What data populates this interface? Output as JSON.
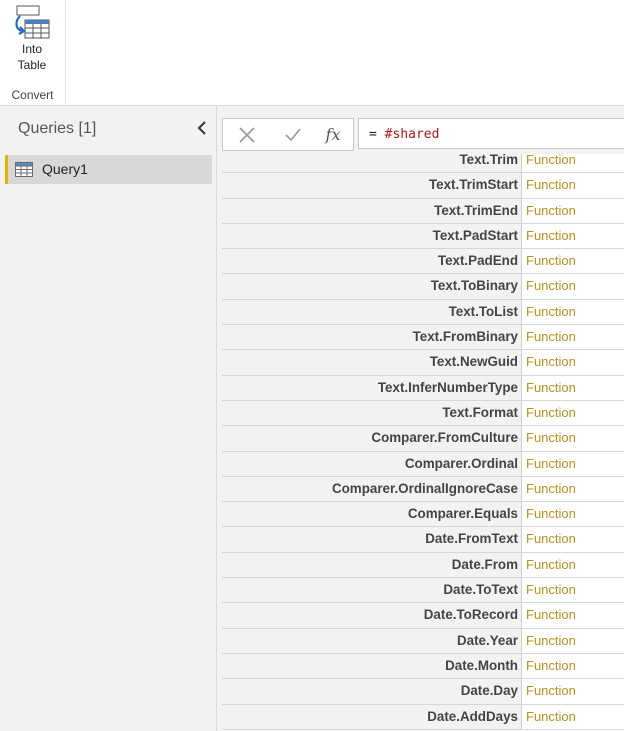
{
  "ribbon": {
    "into_table_line1": "Into",
    "into_table_line2": "Table",
    "group_label": "Convert"
  },
  "queries": {
    "title": "Queries [1]",
    "items": [
      {
        "name": "Query1"
      }
    ]
  },
  "formula": {
    "prefix": "= ",
    "keyword": "#shared"
  },
  "colors": {
    "accent": "#e8b100",
    "function_link": "#b8911f",
    "formula_keyword": "#b0161b"
  },
  "rows": [
    {
      "name": "Text.Trim",
      "value": "Function"
    },
    {
      "name": "Text.TrimStart",
      "value": "Function"
    },
    {
      "name": "Text.TrimEnd",
      "value": "Function"
    },
    {
      "name": "Text.PadStart",
      "value": "Function"
    },
    {
      "name": "Text.PadEnd",
      "value": "Function"
    },
    {
      "name": "Text.ToBinary",
      "value": "Function"
    },
    {
      "name": "Text.ToList",
      "value": "Function"
    },
    {
      "name": "Text.FromBinary",
      "value": "Function"
    },
    {
      "name": "Text.NewGuid",
      "value": "Function"
    },
    {
      "name": "Text.InferNumberType",
      "value": "Function"
    },
    {
      "name": "Text.Format",
      "value": "Function"
    },
    {
      "name": "Comparer.FromCulture",
      "value": "Function"
    },
    {
      "name": "Comparer.Ordinal",
      "value": "Function"
    },
    {
      "name": "Comparer.OrdinalIgnoreCase",
      "value": "Function"
    },
    {
      "name": "Comparer.Equals",
      "value": "Function"
    },
    {
      "name": "Date.FromText",
      "value": "Function"
    },
    {
      "name": "Date.From",
      "value": "Function"
    },
    {
      "name": "Date.ToText",
      "value": "Function"
    },
    {
      "name": "Date.ToRecord",
      "value": "Function"
    },
    {
      "name": "Date.Year",
      "value": "Function"
    },
    {
      "name": "Date.Month",
      "value": "Function"
    },
    {
      "name": "Date.Day",
      "value": "Function"
    },
    {
      "name": "Date.AddDays",
      "value": "Function"
    }
  ]
}
